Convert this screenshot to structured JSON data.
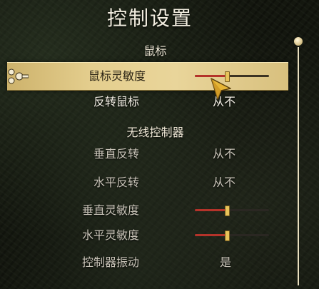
{
  "title": "控制设置",
  "sections": {
    "mouse": "鼠标",
    "wireless": "无线控制器"
  },
  "rows": {
    "mouse_sensitivity": {
      "label": "鼠标灵敏度",
      "slider_value": 0.42
    },
    "invert_mouse": {
      "label": "反转鼠标",
      "value": "从不"
    },
    "invert_vertical": {
      "label": "垂直反转",
      "value": "从不"
    },
    "invert_horizontal": {
      "label": "水平反转",
      "value": "从不"
    },
    "vertical_sensitivity": {
      "label": "垂直灵敏度",
      "slider_value": 0.42
    },
    "horizontal_sensitivity": {
      "label": "水平灵敏度",
      "slider_value": 0.42
    },
    "vibration": {
      "label": "控制器振动",
      "value": "是"
    }
  },
  "colors": {
    "highlight": "#e4ce8e",
    "slider_fill": "#b4332a",
    "slider_handle": "#e8c35a"
  }
}
